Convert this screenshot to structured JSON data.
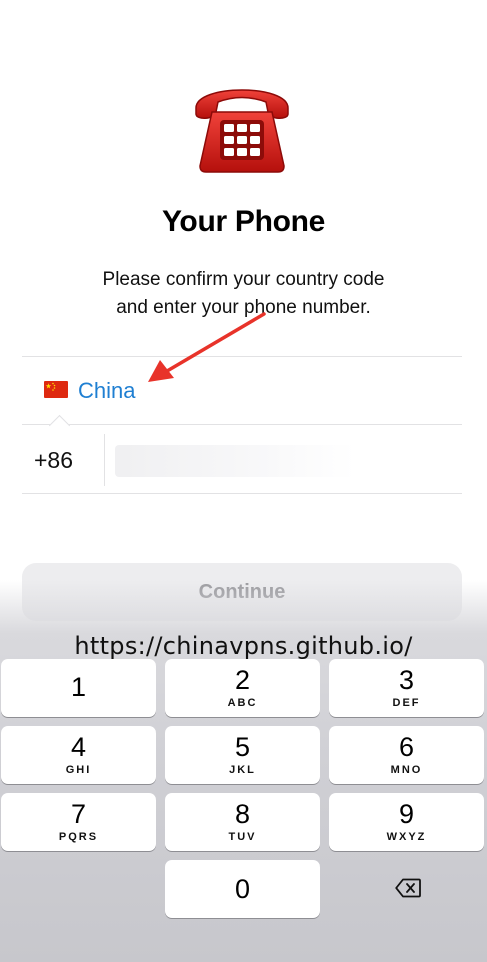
{
  "header": {
    "icon": "telephone-icon",
    "title": "Your Phone",
    "subtitle_line1": "Please confirm your country code",
    "subtitle_line2": "and enter your phone number."
  },
  "country": {
    "flag_icon": "china-flag-icon",
    "name": "China",
    "color": "#1f7fd2"
  },
  "phone": {
    "country_code": "+86",
    "number_value": ""
  },
  "continue_button": {
    "label": "Continue"
  },
  "watermark": "https://chinavpns.github.io/",
  "keypad": {
    "keys": [
      {
        "digit": "1",
        "letters": ""
      },
      {
        "digit": "2",
        "letters": "ABC"
      },
      {
        "digit": "3",
        "letters": "DEF"
      },
      {
        "digit": "4",
        "letters": "GHI"
      },
      {
        "digit": "5",
        "letters": "JKL"
      },
      {
        "digit": "6",
        "letters": "MNO"
      },
      {
        "digit": "7",
        "letters": "PQRS"
      },
      {
        "digit": "8",
        "letters": "TUV"
      },
      {
        "digit": "9",
        "letters": "WXYZ"
      },
      {
        "digit": "0",
        "letters": ""
      }
    ],
    "backspace_icon": "backspace-icon"
  }
}
